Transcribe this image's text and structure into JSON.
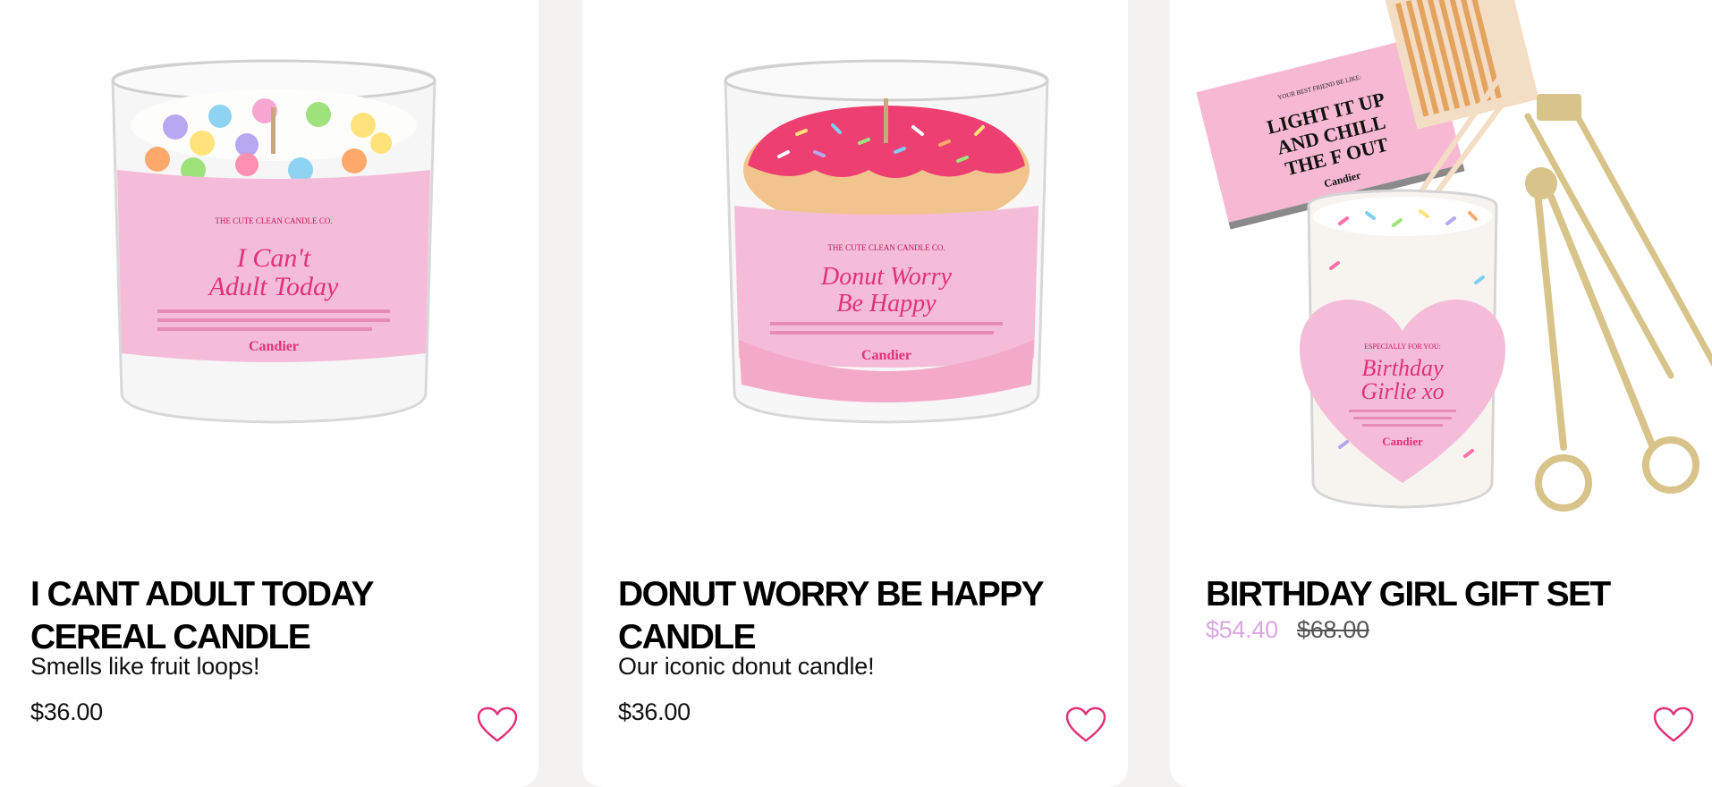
{
  "products": [
    {
      "name": "I CANT ADULT TODAY CEREAL CANDLE",
      "name_line1": "I CANT ADULT TODAY",
      "name_line2": "CEREAL CANDLE",
      "description": "Smells like fruit loops!",
      "price": "$36.00",
      "label": {
        "brand_line": "THE CUTE CLEAN CANDLE CO.",
        "script_line1": "I Can't",
        "script_line2": "Adult Today",
        "logo": "Candier"
      },
      "wishlist_icon": "heart-icon"
    },
    {
      "name": "DONUT WORRY BE HAPPY CANDLE",
      "name_line1": "DONUT WORRY BE HAPPY",
      "name_line2": "CANDLE",
      "description": "Our iconic donut candle!",
      "price": "$36.00",
      "label": {
        "brand_line": "THE CUTE CLEAN CANDLE CO.",
        "script_line1": "Donut Worry",
        "script_line2": "Be Happy",
        "logo": "Candier"
      },
      "wishlist_icon": "heart-icon"
    },
    {
      "name": "BIRTHDAY GIRL GIFT SET",
      "sale_price": "$54.40",
      "original_price": "$68.00",
      "label": {
        "matchbox_small": "YOUR BEST FRIEND BE LIKE:",
        "matchbox_line1": "LIGHT IT UP",
        "matchbox_line2": "AND CHILL",
        "matchbox_line3": "THE F OUT",
        "heart_small": "ESPECIALLY FOR YOU:",
        "script_line1": "Birthday",
        "script_line2": "Girlie xo",
        "logo": "Candier"
      },
      "wishlist_icon": "heart-icon"
    }
  ],
  "colors": {
    "page_bg": "#f4f2f0",
    "card_bg": "#ffffff",
    "label_pink": "#f4bcd8",
    "accent_pink": "#e0327a",
    "sale_price": "#d9a7e0",
    "heart_outline": "#e0327a"
  }
}
